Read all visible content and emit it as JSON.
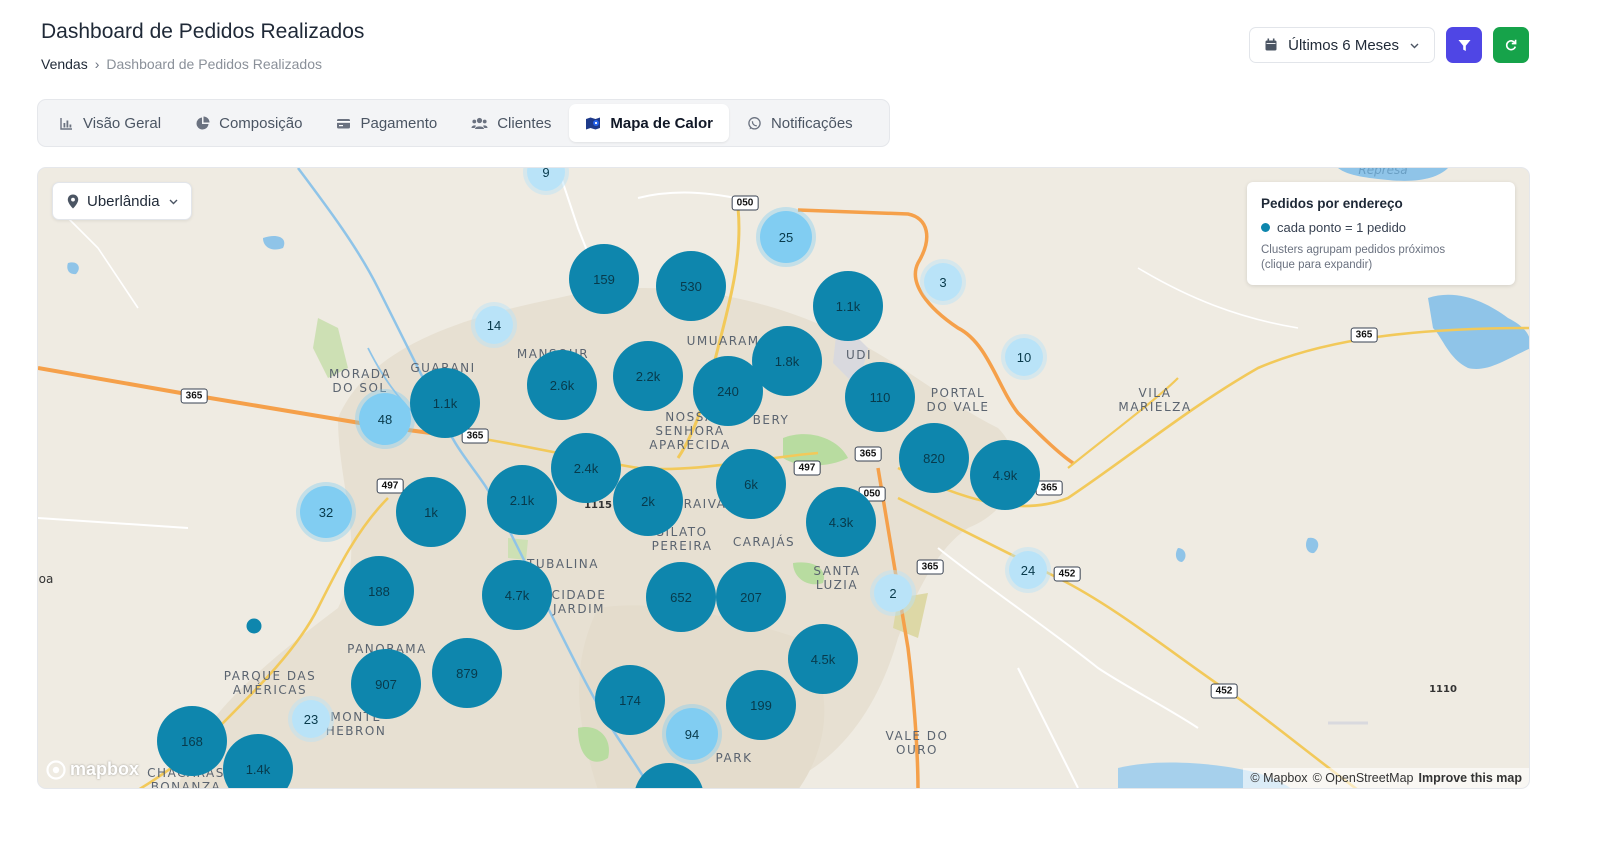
{
  "header": {
    "title": "Dashboard de Pedidos Realizados",
    "breadcrumb": {
      "root": "Vendas",
      "separator": "›",
      "current": "Dashboard de Pedidos Realizados"
    },
    "period_label": "Últimos 6 Meses",
    "filter_icon": "filter-icon",
    "refresh_icon": "refresh-icon"
  },
  "tabs": [
    {
      "label": "Visão Geral",
      "icon": "bar-chart-icon",
      "active": false
    },
    {
      "label": "Composição",
      "icon": "pie-chart-icon",
      "active": false
    },
    {
      "label": "Pagamento",
      "icon": "credit-card-icon",
      "active": false
    },
    {
      "label": "Clientes",
      "icon": "users-icon",
      "active": false
    },
    {
      "label": "Mapa de Calor",
      "icon": "map-icon",
      "active": true
    },
    {
      "label": "Notificações",
      "icon": "whatsapp-icon",
      "active": false
    }
  ],
  "map": {
    "city": "Uberlândia",
    "legend": {
      "title": "Pedidos por endereço",
      "item": "cada ponto = 1 pedido",
      "note_line1": "Clusters agrupam pedidos próximos",
      "note_line2": "(clique para expandir)"
    },
    "attribution": {
      "mapbox": "© Mapbox",
      "osm": "© OpenStreetMap",
      "improve": "Improve this map"
    },
    "logo": "mapbox",
    "clusters": [
      "9",
      "25",
      "159",
      "530",
      "3",
      "14",
      "1.1k",
      "10",
      "2.6k",
      "2.2k",
      "1.8k",
      "240",
      "48",
      "1.1k",
      "110",
      "2.4k",
      "820",
      "4.9k",
      "32",
      "1k",
      "2.1k",
      "2k",
      "6k",
      "4.3k",
      "24",
      "2",
      "188",
      "4.7k",
      "652",
      "207",
      "4.5k",
      "907",
      "879",
      "174",
      "199",
      "23",
      "94",
      "168",
      "1.4k",
      ""
    ],
    "place_labels": {
      "morada_do_sol": [
        "MORADA",
        "DO SOL"
      ],
      "guarani": "GUARANI",
      "mansour": "MANSOUR",
      "umuarama": "UMUARAMA",
      "udi": "UDI",
      "nossa_senhora": [
        "NOSSA",
        "SENHORA",
        "APARECIDA"
      ],
      "bery": "BERY",
      "portal_do_vale": [
        "PORTAL",
        "DO VALE"
      ],
      "vila_marielza": [
        "VILA",
        "MARIELZA"
      ],
      "laraiva": "RAIVA",
      "tubalina": "TUBALINA",
      "cidade_jardim": [
        "CIDADE",
        "JARDIM"
      ],
      "lsilato_pereira": [
        "SILATO",
        "PEREIRA"
      ],
      "carajas": "CARAJÁS",
      "santa_luzia": [
        "SANTA",
        "LUZIA"
      ],
      "panorama": "PANORAMA",
      "parque_das_americas": [
        "PARQUE DAS",
        "AMÉRICAS"
      ],
      "monte_hebron": [
        "MONTE",
        "HEBRON"
      ],
      "vale_do_ouro": [
        "VALE DO",
        "OURO"
      ],
      "park": "PARK",
      "chacaras_bonanza": [
        "CHÁCARAS",
        "BONANZA"
      ],
      "represa": "Represa",
      "oa": "oa"
    },
    "shields": [
      "050",
      "365",
      "365",
      "497",
      "497",
      "365",
      "050",
      "365",
      "365",
      "452",
      "452",
      "365",
      "1110",
      "1115"
    ]
  }
}
